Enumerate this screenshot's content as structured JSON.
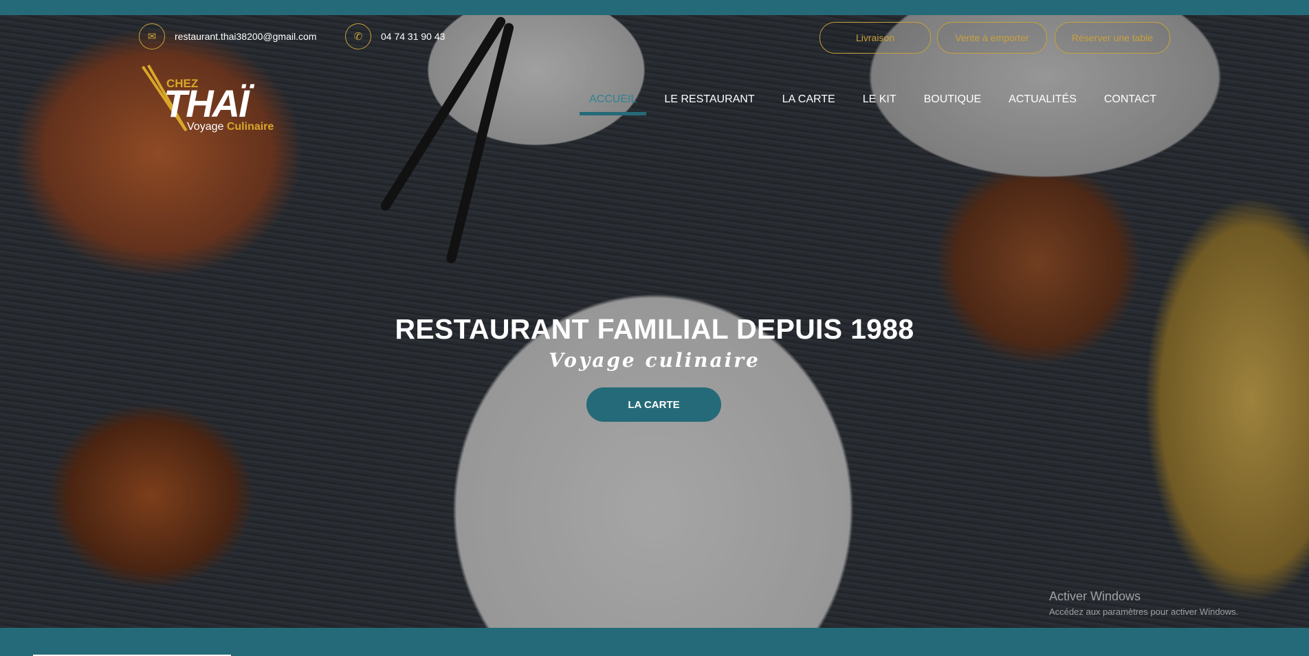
{
  "contact": {
    "email": "restaurant.thai38200@gmail.com",
    "phone": "04 74 31 90 43"
  },
  "header_buttons": [
    {
      "label": "Livraison"
    },
    {
      "label": "Vente à emporter"
    },
    {
      "label": "Réserver une table"
    }
  ],
  "logo": {
    "chez": "CHEZ",
    "thai": "THAÏ",
    "sub_a": "Voyage",
    "sub_b": "Culinaire"
  },
  "nav": [
    {
      "label": "ACCUEIL",
      "active": true
    },
    {
      "label": "LE RESTAURANT"
    },
    {
      "label": "LA CARTE"
    },
    {
      "label": "LE KIT"
    },
    {
      "label": "BOUTIQUE"
    },
    {
      "label": "ACTUALITÉS"
    },
    {
      "label": "CONTACT"
    }
  ],
  "hero": {
    "title": "RESTAURANT FAMILIAL DEPUIS 1988",
    "subtitle": "Voyage culinaire",
    "cta": "LA CARTE"
  },
  "watermark": {
    "title": "Activer Windows",
    "subtitle": "Accédez aux paramètres pour activer Windows."
  },
  "colors": {
    "teal": "#256a78",
    "gold": "#c9a13b",
    "active_nav": "#2f8193"
  },
  "icons": {
    "email": "envelope-icon",
    "phone": "phone-icon"
  }
}
